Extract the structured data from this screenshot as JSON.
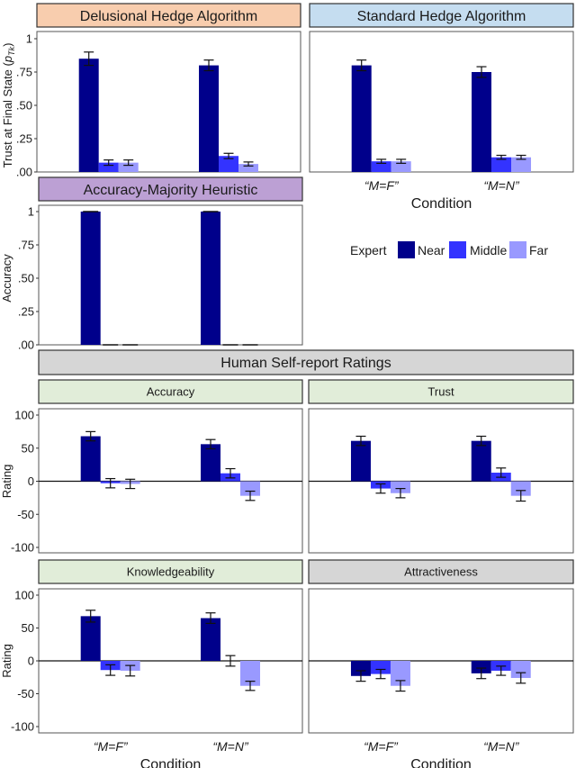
{
  "colors": {
    "Near": "#00008B",
    "Middle": "#3333FF",
    "Far": "#9999FF",
    "strip_delusional": "#F8CDAE",
    "strip_standard": "#C5DDF0",
    "strip_heuristic": "#BCA0D4",
    "strip_human": "#D6D6D6",
    "strip_subpanel_green": "#E1EDD9",
    "strip_subpanel_gray": "#D6D6D6"
  },
  "legend": {
    "title": "Expert",
    "entries": [
      "Near",
      "Middle",
      "Far"
    ]
  },
  "section_titles": {
    "human": "Human Self-report Ratings"
  },
  "chart_data": [
    {
      "id": "delusional",
      "type": "bar",
      "title": "Delusional Hedge Algorithm",
      "xlabel": "",
      "ylabel": "Trust at Final State (p_Tk)",
      "ylim": [
        0,
        1
      ],
      "yticks": [
        0,
        0.25,
        0.5,
        0.75,
        1
      ],
      "ytick_labels": [
        ".00",
        ".25",
        ".50",
        ".75",
        "1"
      ],
      "categories": [
        "“M=F”",
        "“M=N”"
      ],
      "series": [
        {
          "name": "Near",
          "values": [
            0.85,
            0.8
          ],
          "errors": [
            0.05,
            0.04
          ]
        },
        {
          "name": "Middle",
          "values": [
            0.07,
            0.12
          ],
          "errors": [
            0.02,
            0.02
          ]
        },
        {
          "name": "Far",
          "values": [
            0.07,
            0.06
          ],
          "errors": [
            0.02,
            0.015
          ]
        }
      ]
    },
    {
      "id": "standard",
      "type": "bar",
      "title": "Standard Hedge Algorithm",
      "xlabel": "Condition",
      "ylabel": "",
      "ylim": [
        0,
        1
      ],
      "categories": [
        "“M=F”",
        "“M=N”"
      ],
      "series": [
        {
          "name": "Near",
          "values": [
            0.8,
            0.75
          ],
          "errors": [
            0.04,
            0.04
          ]
        },
        {
          "name": "Middle",
          "values": [
            0.08,
            0.11
          ],
          "errors": [
            0.015,
            0.015
          ]
        },
        {
          "name": "Far",
          "values": [
            0.08,
            0.11
          ],
          "errors": [
            0.015,
            0.015
          ]
        }
      ]
    },
    {
      "id": "heuristic",
      "type": "bar",
      "title": "Accuracy-Majority Heuristic",
      "xlabel": "",
      "ylabel": "Accuracy",
      "ylim": [
        0,
        1
      ],
      "yticks": [
        0,
        0.25,
        0.5,
        0.75,
        1
      ],
      "ytick_labels": [
        ".00",
        ".25",
        ".50",
        ".75",
        "1"
      ],
      "categories": [
        "“M=F”",
        "“M=N”"
      ],
      "series": [
        {
          "name": "Near",
          "values": [
            1.0,
            1.0
          ],
          "errors": [
            0.0,
            0.0
          ]
        },
        {
          "name": "Middle",
          "values": [
            0.0,
            0.0
          ],
          "errors": [
            0.0,
            0.0
          ]
        },
        {
          "name": "Far",
          "values": [
            0.0,
            0.0
          ],
          "errors": [
            0.0,
            0.0
          ]
        }
      ]
    },
    {
      "id": "accuracy",
      "type": "bar",
      "title": "Accuracy",
      "xlabel": "",
      "ylabel": "Rating",
      "ylim": [
        -100,
        100
      ],
      "yticks": [
        -100,
        -50,
        0,
        50,
        100
      ],
      "ytick_labels": [
        "-100",
        "-50",
        "0",
        "50",
        "100"
      ],
      "categories": [
        "“M=F”",
        "“M=N”"
      ],
      "series": [
        {
          "name": "Near",
          "values": [
            68,
            56
          ],
          "errors": [
            7,
            7
          ]
        },
        {
          "name": "Middle",
          "values": [
            -3,
            12
          ],
          "errors": [
            7,
            7
          ]
        },
        {
          "name": "Far",
          "values": [
            -4,
            -22
          ],
          "errors": [
            7,
            7
          ]
        }
      ]
    },
    {
      "id": "trust",
      "type": "bar",
      "title": "Trust",
      "xlabel": "",
      "ylabel": "",
      "ylim": [
        -100,
        100
      ],
      "categories": [
        "“M=F”",
        "“M=N”"
      ],
      "series": [
        {
          "name": "Near",
          "values": [
            61,
            61
          ],
          "errors": [
            7,
            7
          ]
        },
        {
          "name": "Middle",
          "values": [
            -11,
            13
          ],
          "errors": [
            7,
            7
          ]
        },
        {
          "name": "Far",
          "values": [
            -18,
            -22
          ],
          "errors": [
            7,
            8
          ]
        }
      ]
    },
    {
      "id": "knowledgeability",
      "type": "bar",
      "title": "Knowledgeability",
      "xlabel": "Condition",
      "ylabel": "Rating",
      "ylim": [
        -100,
        100
      ],
      "yticks": [
        -100,
        -50,
        0,
        50,
        100
      ],
      "ytick_labels": [
        "-100",
        "-50",
        "0",
        "50",
        "100"
      ],
      "categories": [
        "“M=F”",
        "“M=N”"
      ],
      "series": [
        {
          "name": "Near",
          "values": [
            68,
            65
          ],
          "errors": [
            9,
            8
          ]
        },
        {
          "name": "Middle",
          "values": [
            -14,
            0
          ],
          "errors": [
            8,
            8
          ]
        },
        {
          "name": "Far",
          "values": [
            -15,
            -38
          ],
          "errors": [
            8,
            7
          ]
        }
      ]
    },
    {
      "id": "attractiveness",
      "type": "bar",
      "title": "Attractiveness",
      "xlabel": "Condition",
      "ylabel": "",
      "ylim": [
        -100,
        100
      ],
      "categories": [
        "“M=F”",
        "“M=N”"
      ],
      "series": [
        {
          "name": "Near",
          "values": [
            -23,
            -19
          ],
          "errors": [
            8,
            8
          ]
        },
        {
          "name": "Middle",
          "values": [
            -20,
            -15
          ],
          "errors": [
            7,
            7
          ]
        },
        {
          "name": "Far",
          "values": [
            -38,
            -26
          ],
          "errors": [
            8,
            8
          ]
        }
      ]
    }
  ]
}
